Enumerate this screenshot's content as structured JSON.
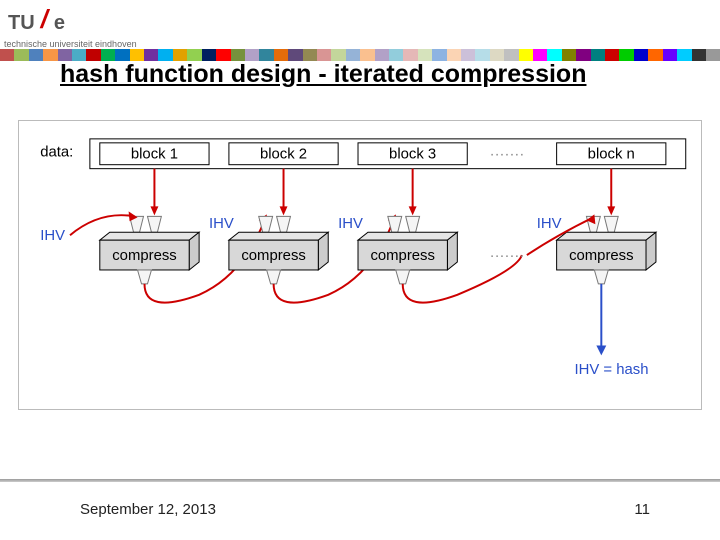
{
  "header": {
    "logo_tu": "TU",
    "logo_slash": "/",
    "logo_e": "e",
    "subtitle": "technische universiteit eindhoven"
  },
  "title": "hash function design - iterated compression",
  "diagram": {
    "data_label": "data:",
    "blocks": [
      "block 1",
      "block 2",
      "block 3",
      "block n"
    ],
    "ihv_label": "IHV",
    "compress_label": "compress",
    "dots": "·······",
    "output": "IHV = hash"
  },
  "footer": {
    "date": "September 12, 2013",
    "page": "11"
  },
  "rainbow_colors": [
    "#c0504d",
    "#9bbb59",
    "#4f81bd",
    "#f79646",
    "#8064a2",
    "#4bacc6",
    "#c00000",
    "#00b050",
    "#0070c0",
    "#ffc000",
    "#7030a0",
    "#00b0f0",
    "#e2a100",
    "#92d050",
    "#002060",
    "#ff0000",
    "#76923c",
    "#b2a1c7",
    "#31859c",
    "#e46c0a",
    "#5f497a",
    "#938953",
    "#d99594",
    "#c3d69b",
    "#95b3d7",
    "#fac08f",
    "#b2a1c7",
    "#92cddc",
    "#e5b8b7",
    "#d6e3bc",
    "#8db3e2",
    "#fbd4b4",
    "#ccc0d9",
    "#b6dde8",
    "#ddd9c3",
    "#c0c0c0",
    "#ffff00",
    "#ff00ff",
    "#00ffff",
    "#808000",
    "#800080",
    "#008080",
    "#c00",
    "#0c0",
    "#00c",
    "#f60",
    "#60f",
    "#0cf",
    "#333",
    "#999"
  ]
}
